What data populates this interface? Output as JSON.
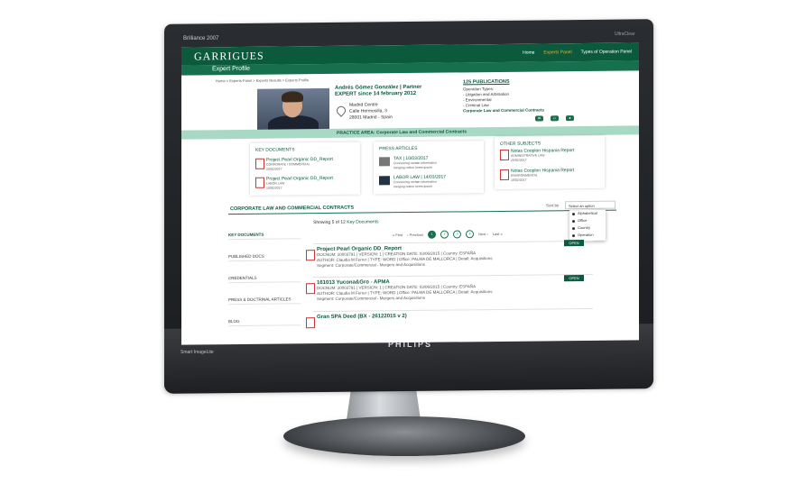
{
  "monitor": {
    "top_label": "Brilliance 2007",
    "top_right_label": "UltraClear",
    "brand": "PHILIPS",
    "chin_left": "Smart ImageLite",
    "chin_right": "○ ○ ○ ○ ○"
  },
  "site": {
    "logo": "GARRIGUES",
    "nav": [
      "Home",
      "Experts Panel",
      "Types of Operation Panel"
    ],
    "page_title": "Expert Profile",
    "breadcrumb": "Home > Experts Panel > Experts Results > Experts Profile"
  },
  "profile": {
    "name": "Andrés Gómez González | Partner",
    "since": "EXPERT since 14 february 2012",
    "address": [
      "Madrid Centre",
      "Calle Hermosilla, 3",
      "28001 Madrid - Spain"
    ],
    "publications": "125 PUBLICATIONS",
    "ops_title": "Operation Types:",
    "ops": [
      "- Litigation and Arbitration",
      "- Environmental",
      "- Criminal Law",
      "Corporate Law and Commercial Contracts"
    ],
    "practice_area": "PRACTICE AREA: Corporate Law and Commercial Contracts"
  },
  "cards": {
    "key_docs": {
      "title": "KEY DOCUMENTS",
      "items": [
        {
          "title": "Project Pearl Organic DD_Report",
          "cat": "CORPORATE / COMMERCIAL",
          "date": "25/02/2017"
        },
        {
          "title": "Project Pearl Organic DD_Report",
          "cat": "LABOR LAW",
          "date": "10/02/2017"
        }
      ]
    },
    "press": {
      "title": "PRESS ARTICLES",
      "items": [
        {
          "title": "TAX | 10/03/2017",
          "l1": "Concerning certain information",
          "l2": "merging notice lorem ipsum"
        },
        {
          "title": "LABOR LAW | 14/03/2017",
          "l1": "Concerning certain information",
          "l2": "merging notice lorem ipsum"
        }
      ]
    },
    "other": {
      "title": "OTHER SUBJECTS",
      "items": [
        {
          "title": "Notas Cooplon Hispania Report",
          "cat": "ADMINISTRATIVE LAW",
          "date": "25/02/2017"
        },
        {
          "title": "Notas Cooplon Hispania Report",
          "cat": "ENVIRONMENTAL",
          "date": "10/02/2017"
        }
      ]
    }
  },
  "list": {
    "section_title": "CORPORATE LAW AND COMMERCIAL CONTRACTS",
    "sort_label": "Sort by",
    "select_value": "Select an option",
    "menu": [
      "Alphabetical",
      "Office",
      "Country",
      "Operation"
    ],
    "showing": "Showing 5 of 12",
    "showing_link": "Key Documents",
    "pager": {
      "first": "« First",
      "prev": "‹ Previous",
      "pages": [
        "1",
        "2",
        "3",
        "4"
      ],
      "next": "Next ›",
      "last": "Last »"
    },
    "side": [
      "KEY DOCUMENTS",
      "PUBLISHED DOCS",
      "CREDENTIALS",
      "PRESS & DOCTRINAL ARTICLES",
      "BLOG"
    ],
    "results": [
      {
        "title": "Project Pearl Organic DD_Report",
        "l1": "DOCNUM: 20003791 | VERSION: 1 | CREATION DATE: 03/06/2015 | Country: ESPAÑA",
        "l2": "AUTHOR: Claudia M Ferrer | TYPE: WORD | Office: PALMA DE MALLORCA | Detail: Acquisitions",
        "l3": "Segment: Corporate/Commercial - Mergers and Acquisitions",
        "open": "OPEN"
      },
      {
        "title": "161013 Yucona&Gro - APMA",
        "l1": "DOCNUM: 20003791 | VERSION: 1 | CREATION DATE: 03/06/2015 | Country: ESPAÑA",
        "l2": "AUTHOR: Claudia M Ferrer | TYPE: WORD | Office: PALMA DE MALLORCA | Detail: Acquisitions",
        "l3": "Segment: Corporate/Commercial - Mergers and Acquisitions",
        "open": "OPEN"
      },
      {
        "title": "Gran SPA Deed (BX - 26122015 v 2)"
      }
    ]
  }
}
